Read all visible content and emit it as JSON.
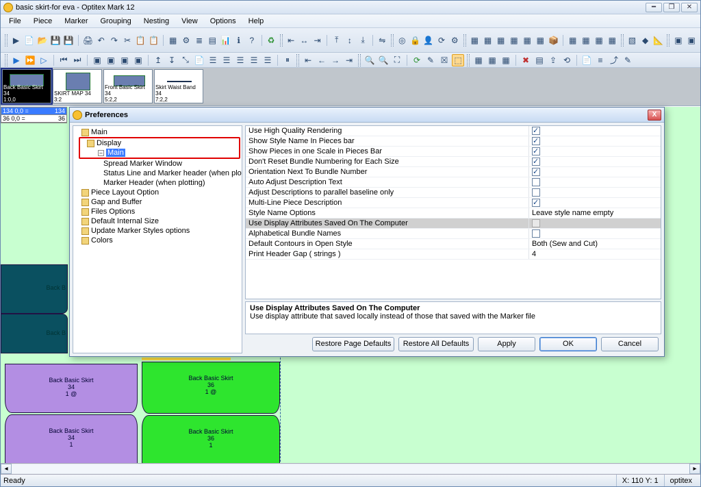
{
  "window": {
    "title": "basic skirt-for eva - Optitex Mark 12"
  },
  "menu": {
    "items": [
      "File",
      "Piece",
      "Marker",
      "Grouping",
      "Nesting",
      "View",
      "Options",
      "Help"
    ]
  },
  "deck": {
    "cards": [
      {
        "name": "Back Basic Skirt 34",
        "info": "1:0,0"
      },
      {
        "name": "SKIRT MAP 34",
        "info": "3:2"
      },
      {
        "name": "Front Basic Skirt 34",
        "info": "5:2,2"
      },
      {
        "name": "Skirt Waist Band 34",
        "info": "7:2,2"
      }
    ]
  },
  "sidebar": {
    "rows": [
      {
        "left": "134  0,0 =",
        "right": "134"
      },
      {
        "left": "36  0,0 =",
        "right": "36"
      }
    ]
  },
  "workspace_pieces": {
    "violet1": {
      "label": "Back Basic Skirt\n34\n1 @"
    },
    "violet2": {
      "label": "Back Basic Skirt\n34\n1"
    },
    "green1": {
      "label": "Back Basic Skirt\n36\n1 @"
    },
    "green2": {
      "label": "Back Basic Skirt\n36\n1"
    },
    "stub1": {
      "label": "Back B"
    },
    "stub2": {
      "label": "Back B"
    }
  },
  "dialog": {
    "title": "Preferences",
    "tree": [
      {
        "lvl": 1,
        "type": "folder",
        "label": "Main"
      },
      {
        "lvl": 1,
        "type": "folder",
        "label": "Display",
        "selGroup": true,
        "highlight": true
      },
      {
        "lvl": 2,
        "type": "leaf",
        "label": "Main",
        "selected": true,
        "plus": true
      },
      {
        "lvl": 3,
        "type": "leaf",
        "label": "Spread Marker Window"
      },
      {
        "lvl": 3,
        "type": "leaf",
        "label": "Status Line and Marker header (when plotting)"
      },
      {
        "lvl": 3,
        "type": "leaf",
        "label": "Marker Header (when plotting)"
      },
      {
        "lvl": 1,
        "type": "folder",
        "label": "Piece Layout Option"
      },
      {
        "lvl": 1,
        "type": "folder",
        "label": "Gap and Buffer"
      },
      {
        "lvl": 1,
        "type": "folder",
        "label": "Files Options"
      },
      {
        "lvl": 1,
        "type": "folder",
        "label": "Default Internal Size"
      },
      {
        "lvl": 1,
        "type": "folder",
        "label": "Update Marker Styles options"
      },
      {
        "lvl": 1,
        "type": "folder",
        "label": "Colors"
      }
    ],
    "options": [
      {
        "name": "Use High Quality Rendering",
        "type": "check",
        "value": true
      },
      {
        "name": "Show Style Name In Pieces bar",
        "type": "check",
        "value": true
      },
      {
        "name": "Show Pieces in one Scale in Pieces Bar",
        "type": "check",
        "value": true
      },
      {
        "name": "Don't Reset Bundle Numbering for Each Size",
        "type": "check",
        "value": true
      },
      {
        "name": "Orientation Next To Bundle Number",
        "type": "check",
        "value": true
      },
      {
        "name": "Auto Adjust Description Text",
        "type": "check",
        "value": false
      },
      {
        "name": "Adjust Descriptions to parallel baseline only",
        "type": "check",
        "value": false
      },
      {
        "name": "Multi-Line Piece Description",
        "type": "check",
        "value": true
      },
      {
        "name": "Style Name Options",
        "type": "text",
        "value": "Leave style name empty"
      },
      {
        "name": "Use Display Attributes Saved On The Computer",
        "type": "check",
        "value": false,
        "selected": true,
        "disabled": true
      },
      {
        "name": "Alphabetical Bundle Names",
        "type": "check",
        "value": false
      },
      {
        "name": "Default Contours in Open Style",
        "type": "text",
        "value": "Both (Sew and Cut)"
      },
      {
        "name": "Print Header Gap ( strings )",
        "type": "text",
        "value": "4"
      }
    ],
    "help": {
      "title": "Use Display Attributes Saved On The Computer",
      "body": "Use display attribute that saved locally instead of those that saved with the Marker file"
    },
    "buttons": {
      "restore_page": "Restore Page Defaults",
      "restore_all": "Restore All Defaults",
      "apply": "Apply",
      "ok": "OK",
      "cancel": "Cancel"
    }
  },
  "status": {
    "left": "Ready",
    "xy": "X: 110  Y: 1",
    "brand": "optitex"
  }
}
